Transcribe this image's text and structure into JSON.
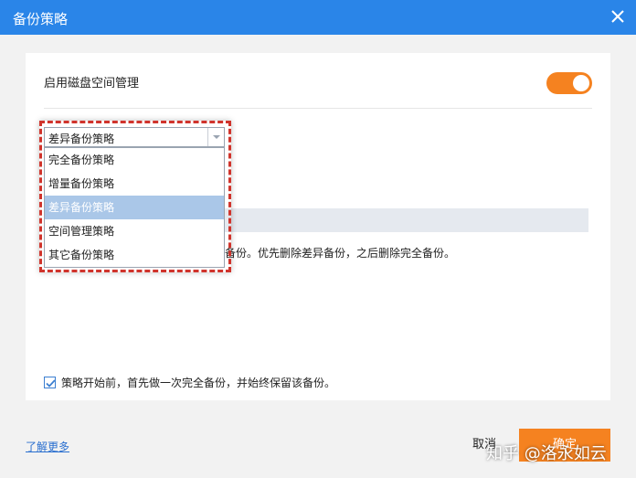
{
  "window": {
    "title": "备份策略",
    "close_icon": "close-icon"
  },
  "panel": {
    "enable_label": "启用磁盘空间管理",
    "toggle_state": "on",
    "toggle_color": "#f58220",
    "description": "备份。优先删除差异备份，之后删除完全备份。",
    "checkbox_label": "策略开始前，首先做一次完全备份，并始终保留该备份。",
    "checkbox_checked": true
  },
  "dropdown": {
    "selected": "差异备份策略",
    "options": [
      "完全备份策略",
      "增量备份策略",
      "差异备份策略",
      "空间管理策略",
      "其它备份策略"
    ],
    "highlighted_index": 2
  },
  "footer": {
    "learn_more": "了解更多",
    "cancel": "取消",
    "ok": "确定"
  },
  "watermark": "知乎 @洛永如云",
  "colors": {
    "titlebar": "#2a85e8",
    "accent": "#f58220",
    "highlight_border": "#d0342c"
  }
}
